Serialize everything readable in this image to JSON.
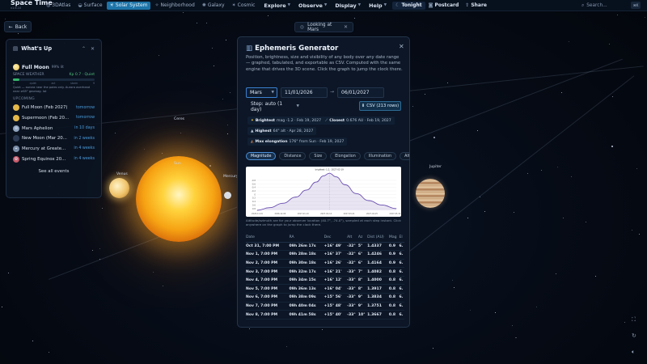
{
  "app": {
    "title": "Space Time",
    "version": "v1.6.10"
  },
  "topbar": {
    "scales": [
      {
        "label": "3DAtlas",
        "icon": "atlas-icon",
        "active": false
      },
      {
        "label": "Surface",
        "icon": "surface-icon",
        "active": false
      },
      {
        "label": "Solar System",
        "icon": "sun-icon",
        "active": true
      },
      {
        "label": "Neighborhood",
        "icon": "star-icon",
        "active": false
      },
      {
        "label": "Galaxy",
        "icon": "galaxy-icon",
        "active": false
      },
      {
        "label": "Cosmic",
        "icon": "cosmic-icon",
        "active": false
      }
    ],
    "menus": [
      "Explore",
      "Observe",
      "Display",
      "Help"
    ],
    "tonight": "Tonight",
    "postcard": "Postcard",
    "share": "Share",
    "search_placeholder": "Search...",
    "shortcut": "⌘K"
  },
  "scene": {
    "back_label": "Back",
    "looking_at": "Looking at Mars",
    "labels": {
      "venus": "Venus",
      "sun": "Sun",
      "mercury": "Mercury",
      "ceres": "Ceres",
      "jupiter": "Jupiter"
    }
  },
  "whats_up": {
    "title": "What's Up",
    "full_moon": "Full Moon",
    "full_moon_pct": "99% lit",
    "space_weather_label": "SPACE WEATHER",
    "kp": "Kp 0.7 · Quiet",
    "kp_level": 0.08,
    "scale": [
      "0",
      "quiet",
      "act",
      "storm",
      "9"
    ],
    "note": "Quiet — aurora near the poles only. Aurora overhead near ≥65° geomag. lat",
    "upcoming_label": "UPCOMING",
    "events": [
      {
        "name": "Full Moon (Feb 2027)",
        "when": "tomorrow",
        "icon": "moon-icon",
        "color": "#e4b84a"
      },
      {
        "name": "Supermoon (Feb 20...",
        "when": "tomorrow",
        "icon": "moon-icon",
        "color": "#e4b84a"
      },
      {
        "name": "Mars Aphelion",
        "when": "in 10 days",
        "icon": "orbit-icon",
        "color": "#8fa3bd"
      },
      {
        "name": "New Moon (Mar 20...",
        "when": "in 2 weeks",
        "icon": "moon-icon",
        "color": "#2b3a52"
      },
      {
        "name": "Mercury at Greate...",
        "when": "in 4 weeks",
        "icon": "telescope-icon",
        "color": "#7b8ea8"
      },
      {
        "name": "Spring Equinox 20...",
        "when": "in 4 weeks",
        "icon": "leaf-icon",
        "color": "#c85a6a"
      }
    ],
    "see_all": "See all events"
  },
  "ephemeris": {
    "title": "Ephemeris Generator",
    "description": "Position, brightness, size and visibility of any body over any date range — graphed, tabulated, and exportable as CSV. Computed with the same engine that drives the 3D scene. Click the graph to jump the clock there.",
    "body": "Mars",
    "start_date": "11/01/2026",
    "end_date": "06/01/2027",
    "step": "Step: auto (1 day)",
    "csv_label": "CSV (213 rows)",
    "brightest_label": "Brightest",
    "brightest_value": "mag -1.2 · Feb 19, 2027",
    "closest_label": "Closest",
    "closest_value": "0.676 AU · Feb 19, 2027",
    "highest_label": "Highest",
    "highest_value": "64° alt · Apr 28, 2027",
    "max_elong_label": "Max elongation",
    "max_elong_value": "176° from Sun · Feb 19, 2027",
    "tabs": [
      {
        "label": "Magnitude",
        "active": true
      },
      {
        "label": "Distance",
        "active": false
      },
      {
        "label": "Size",
        "active": false
      },
      {
        "label": "Elongation",
        "active": false
      },
      {
        "label": "Illumination",
        "active": false
      },
      {
        "label": "Altitude",
        "active": false
      }
    ],
    "plot_note": "Altitude/azimuth are for your observer location (40.7°, -74.0°), sampled at each step instant. Click anywhere on the graph to jump the clock there.",
    "table": {
      "headers": [
        "Date",
        "RA",
        "Dec",
        "Alt",
        "Az",
        "Dist (AU)",
        "Mag",
        "El"
      ],
      "rows": [
        [
          "Oct 31, 7:00 PM",
          "09h 26m 17s",
          "+16° 49'",
          "-32°",
          "5°",
          "1.4337",
          "0.9",
          "6."
        ],
        [
          "Nov 1, 7:00 PM",
          "09h 28m 18s",
          "+16° 37'",
          "-32°",
          "6°",
          "1.4246",
          "0.9",
          "6."
        ],
        [
          "Nov 2, 7:00 PM",
          "09h 30m 18s",
          "+16° 26'",
          "-32°",
          "6°",
          "1.4164",
          "0.9",
          "6."
        ],
        [
          "Nov 3, 7:00 PM",
          "09h 32m 17s",
          "+16° 21'",
          "-33°",
          "7°",
          "1.4082",
          "0.8",
          "6."
        ],
        [
          "Nov 4, 7:00 PM",
          "09h 34m 15s",
          "+16° 12'",
          "-33°",
          "8°",
          "1.4000",
          "0.8",
          "6."
        ],
        [
          "Nov 5, 7:00 PM",
          "09h 36m 13s",
          "+16° 04'",
          "-33°",
          "8°",
          "1.3917",
          "0.8",
          "6."
        ],
        [
          "Nov 6, 7:00 PM",
          "09h 38m 09s",
          "+15° 56'",
          "-33°",
          "9°",
          "1.3834",
          "0.8",
          "6."
        ],
        [
          "Nov 7, 7:00 PM",
          "09h 40m 04s",
          "+15° 48'",
          "-33°",
          "9°",
          "1.3751",
          "0.8",
          "6."
        ],
        [
          "Nov 8, 7:00 PM",
          "09h 41m 58s",
          "+15° 40'",
          "-33°",
          "10°",
          "1.3667",
          "0.8",
          "6."
        ]
      ]
    }
  },
  "chart_data": {
    "type": "line",
    "title": "",
    "annotation": "brightest -1.2 · 2027-02-19",
    "x_ticks": [
      "2026-11-01",
      "2026-12-06",
      "2027-01-10",
      "2027-02-14",
      "2027-03-21",
      "2027-04-25",
      "2027-05-30"
    ],
    "y_ticks": [
      -0.8,
      -0.6,
      -0.4,
      -0.2,
      0,
      0.2,
      0.4,
      0.6,
      0.8
    ],
    "ylim": [
      0.9,
      -1.3
    ],
    "x": [
      "2026-11-01",
      "2026-11-20",
      "2026-12-10",
      "2026-12-30",
      "2027-01-15",
      "2027-01-30",
      "2027-02-10",
      "2027-02-19",
      "2027-03-01",
      "2027-03-15",
      "2027-04-01",
      "2027-04-20",
      "2027-05-10",
      "2027-06-01"
    ],
    "values": [
      0.9,
      0.75,
      0.5,
      0.15,
      -0.25,
      -0.7,
      -1.05,
      -1.2,
      -1.0,
      -0.55,
      -0.05,
      0.35,
      0.6,
      0.8
    ],
    "color": "#6a4fb0"
  }
}
